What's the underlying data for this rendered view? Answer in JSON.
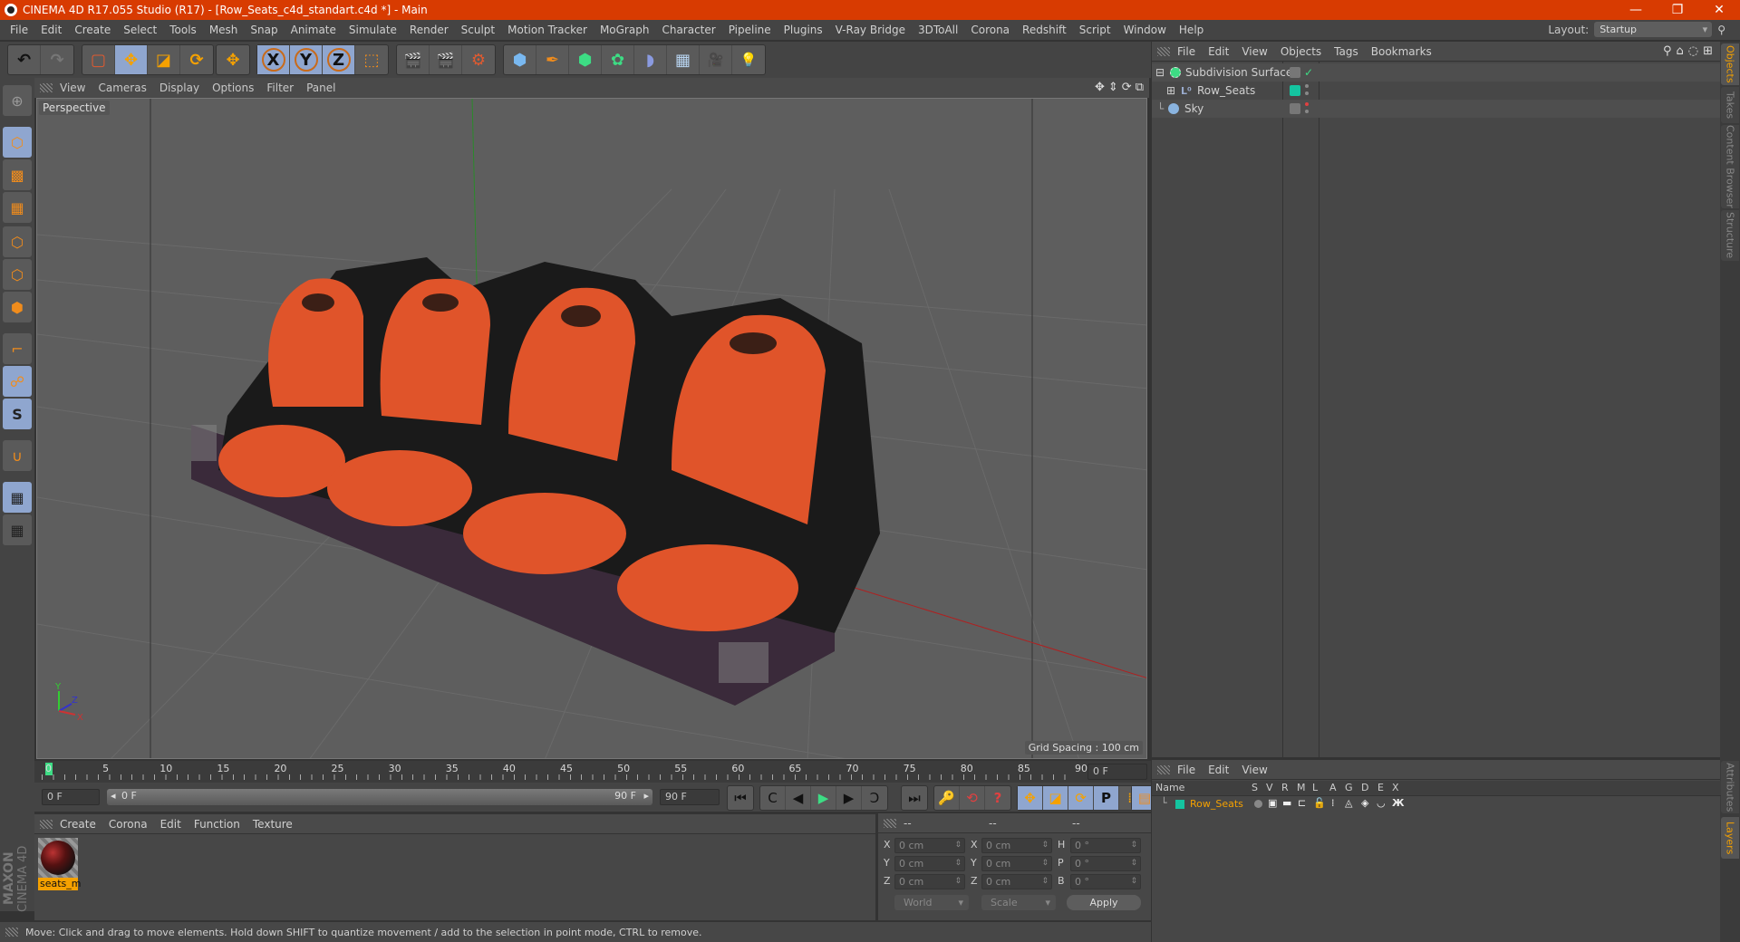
{
  "titlebar": {
    "title": "CINEMA 4D R17.055 Studio (R17) - [Row_Seats_c4d_standart.c4d *] - Main",
    "minimize": "—",
    "restore": "❐",
    "close": "✕"
  },
  "menubar": {
    "items": [
      "File",
      "Edit",
      "Create",
      "Select",
      "Tools",
      "Mesh",
      "Snap",
      "Animate",
      "Simulate",
      "Render",
      "Sculpt",
      "Motion Tracker",
      "MoGraph",
      "Character",
      "Pipeline",
      "Plugins",
      "V-Ray Bridge",
      "3DToAll",
      "Corona",
      "Redshift",
      "Script",
      "Window",
      "Help"
    ],
    "layout_label": "Layout:",
    "layout_value": "Startup"
  },
  "toolbar": {
    "undo": "↶",
    "redo": "↷",
    "select": "▢",
    "move": "✥",
    "scale": "◪",
    "rotate": "⟳",
    "transform": "✥",
    "x_axis": "X",
    "y_axis": "Y",
    "z_axis": "Z",
    "coord_system": "⬚",
    "render_view": "🎬",
    "render_picture": "🎬",
    "render_settings": "⚙",
    "cube": "⬢",
    "pen": "✒",
    "subdivision": "⬢",
    "cloner": "✿",
    "deformer": "◗",
    "floor": "▦",
    "camera": "🎥",
    "light": "💡"
  },
  "left_toolbar": {
    "make_editable": "⊕",
    "model_mode": "⬡",
    "texture_mode": "▩",
    "workplane": "▦",
    "points": "⬡",
    "edges": "⬡",
    "polygons": "⬢",
    "axis": "⌐",
    "tweak": "☍",
    "snap": "S",
    "magnet": "∪",
    "lock_workplane": "▦",
    "workplane_cycle": "▦"
  },
  "viewport": {
    "menus": [
      "View",
      "Cameras",
      "Display",
      "Options",
      "Filter",
      "Panel"
    ],
    "camera_label": "Perspective",
    "grid_spacing": "Grid Spacing : 100 cm",
    "nav_icons": [
      "✥",
      "⇕",
      "⟳",
      "⧉"
    ],
    "axis_labels": {
      "y": "Y",
      "z": "Z",
      "x": "X"
    }
  },
  "timeline": {
    "ticks": [
      "0",
      "5",
      "10",
      "15",
      "20",
      "25",
      "30",
      "35",
      "40",
      "45",
      "50",
      "55",
      "60",
      "65",
      "70",
      "75",
      "80",
      "85",
      "90"
    ],
    "current_frame_right": "0 F",
    "start_frame": "0 F",
    "range_start": "0 F",
    "range_end": "90 F",
    "end_frame": "90 F",
    "current_frame_normalized": 0
  },
  "playback": {
    "go_start": "⏮",
    "prev_key": "C",
    "prev_frame": "◀",
    "play": "▶",
    "next_frame": "▶",
    "next_key": "Ↄ",
    "go_end": "⏭",
    "keyframe_selection": "🔑",
    "autokey": "⟲",
    "keyframe_help": "?",
    "key_pos": "✥",
    "key_scale": "◪",
    "key_rot": "⟳",
    "key_param": "P",
    "key_pla": "⁞⁞",
    "timeline_window": "▤"
  },
  "material_manager": {
    "menus": [
      "Create",
      "Corona",
      "Edit",
      "Function",
      "Texture"
    ],
    "materials": [
      {
        "name": "seats_m"
      }
    ],
    "brand_top": "MAXON",
    "brand_bottom": "CINEMA 4D"
  },
  "coordinates": {
    "header": [
      "--",
      "--",
      "--"
    ],
    "rows": [
      {
        "l1": "X",
        "v1": "0 cm",
        "l2": "X",
        "v2": "0 cm",
        "l3": "H",
        "v3": "0 °"
      },
      {
        "l1": "Y",
        "v1": "0 cm",
        "l2": "Y",
        "v2": "0 cm",
        "l3": "P",
        "v3": "0 °"
      },
      {
        "l1": "Z",
        "v1": "0 cm",
        "l2": "Z",
        "v2": "0 cm",
        "l3": "B",
        "v3": "0 °"
      }
    ],
    "space": "World",
    "mode": "Scale",
    "apply": "Apply"
  },
  "status_bar": {
    "text": "Move: Click and drag to move elements. Hold down SHIFT to quantize movement / add to the selection in point mode, CTRL to remove."
  },
  "object_manager": {
    "menus": [
      "File",
      "Edit",
      "View",
      "Objects",
      "Tags",
      "Bookmarks"
    ],
    "objects": [
      {
        "name": "Subdivision Surface",
        "expander": "⊟",
        "layer_color": null,
        "check": "✓"
      },
      {
        "name": "Row_Seats",
        "expander": "⊞",
        "layer_color": "#14c4a0"
      },
      {
        "name": "Sky",
        "expander": "",
        "layer_color": null,
        "render_dot": "#e04040"
      }
    ]
  },
  "side_tabs": {
    "top": [
      "Objects",
      "Takes",
      "Content Browser",
      "Structure"
    ],
    "bottom": [
      "Attributes",
      "Layers"
    ]
  },
  "layer_manager": {
    "menus": [
      "File",
      "Edit",
      "View"
    ],
    "columns": [
      "Name",
      "S",
      "V",
      "R",
      "M",
      "L",
      "A",
      "G",
      "D",
      "E",
      "X"
    ],
    "layers": [
      {
        "name": "Row_Seats",
        "color": "#14c4a0"
      }
    ]
  },
  "colors": {
    "title_bar": "#d83b01",
    "accent_orange": "#f5a100",
    "active_blue": "#8fa6cf",
    "layer_teal": "#14c4a0"
  }
}
